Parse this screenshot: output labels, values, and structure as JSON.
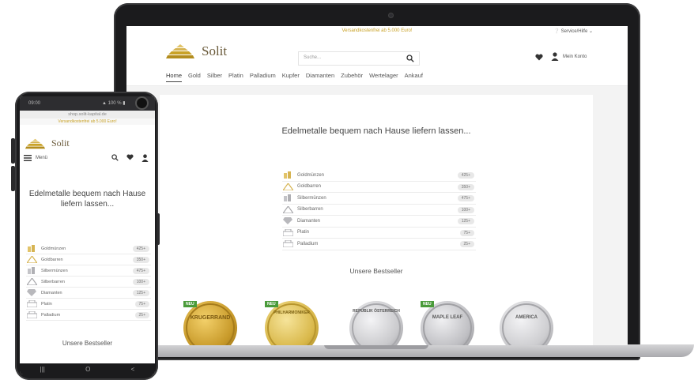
{
  "laptop": {
    "top_bar": {
      "shipping_note": "Versandkostenfrei ab 5.000 Euro!",
      "service_label": "Service/Hilfe"
    },
    "header": {
      "logo_text": "Solit",
      "search_placeholder": "Suche...",
      "account_label": "Mein Konto"
    },
    "nav": [
      "Home",
      "Gold",
      "Silber",
      "Platin",
      "Palladium",
      "Kupfer",
      "Diamanten",
      "Zubehör",
      "Wertelager",
      "Ankauf"
    ],
    "hero_text": "Edelmetalle bequem nach Hause liefern lassen...",
    "categories": [
      {
        "name": "Goldmünzen",
        "count": "425+",
        "icon": "gold-coins-icon"
      },
      {
        "name": "Goldbarren",
        "count": "350+",
        "icon": "gold-bars-icon"
      },
      {
        "name": "Silbermünzen",
        "count": "475+",
        "icon": "silver-coins-icon"
      },
      {
        "name": "Silberbarren",
        "count": "100+",
        "icon": "silver-bars-icon"
      },
      {
        "name": "Diamanten",
        "count": "125+",
        "icon": "diamond-icon"
      },
      {
        "name": "Platin",
        "count": "75+",
        "icon": "platinum-bars-icon"
      },
      {
        "name": "Palladium",
        "count": "25+",
        "icon": "palladium-bars-icon"
      }
    ],
    "bestseller_title": "Unsere Bestseller",
    "products": [
      {
        "badge": "NEU",
        "coin_text": "KRUGERRAND",
        "color": "#c89a2a"
      },
      {
        "badge": "NEU",
        "coin_text": "PHILHARMONIKER",
        "color": "#d9b84a"
      },
      {
        "badge": "",
        "coin_text": "REPUBLIK ÖSTERREICH",
        "color": "#c9c9cc"
      },
      {
        "badge": "NEU",
        "coin_text": "MAPLE LEAF",
        "color": "#bfbfc3"
      },
      {
        "badge": "",
        "coin_text": "AMERICA",
        "color": "#cdcdd0"
      }
    ]
  },
  "phone": {
    "status": {
      "time": "09:00",
      "battery": "100 %"
    },
    "url": "shop.solit-kapital.de",
    "shipping_note": "Versandkostenfrei ab 5.000 Euro!",
    "logo_text": "Solit",
    "menu_label": "Menü",
    "hero_text": "Edelmetalle bequem nach Hause liefern lassen...",
    "bestseller_title": "Unsere Bestseller",
    "nav_buttons": [
      "|||",
      "O",
      "<"
    ]
  },
  "colors": {
    "gold": "#c9a227",
    "logo_text": "#6a5a3a",
    "badge_bg": "#e8e8e8",
    "neu_badge": "#4a9b3a"
  }
}
